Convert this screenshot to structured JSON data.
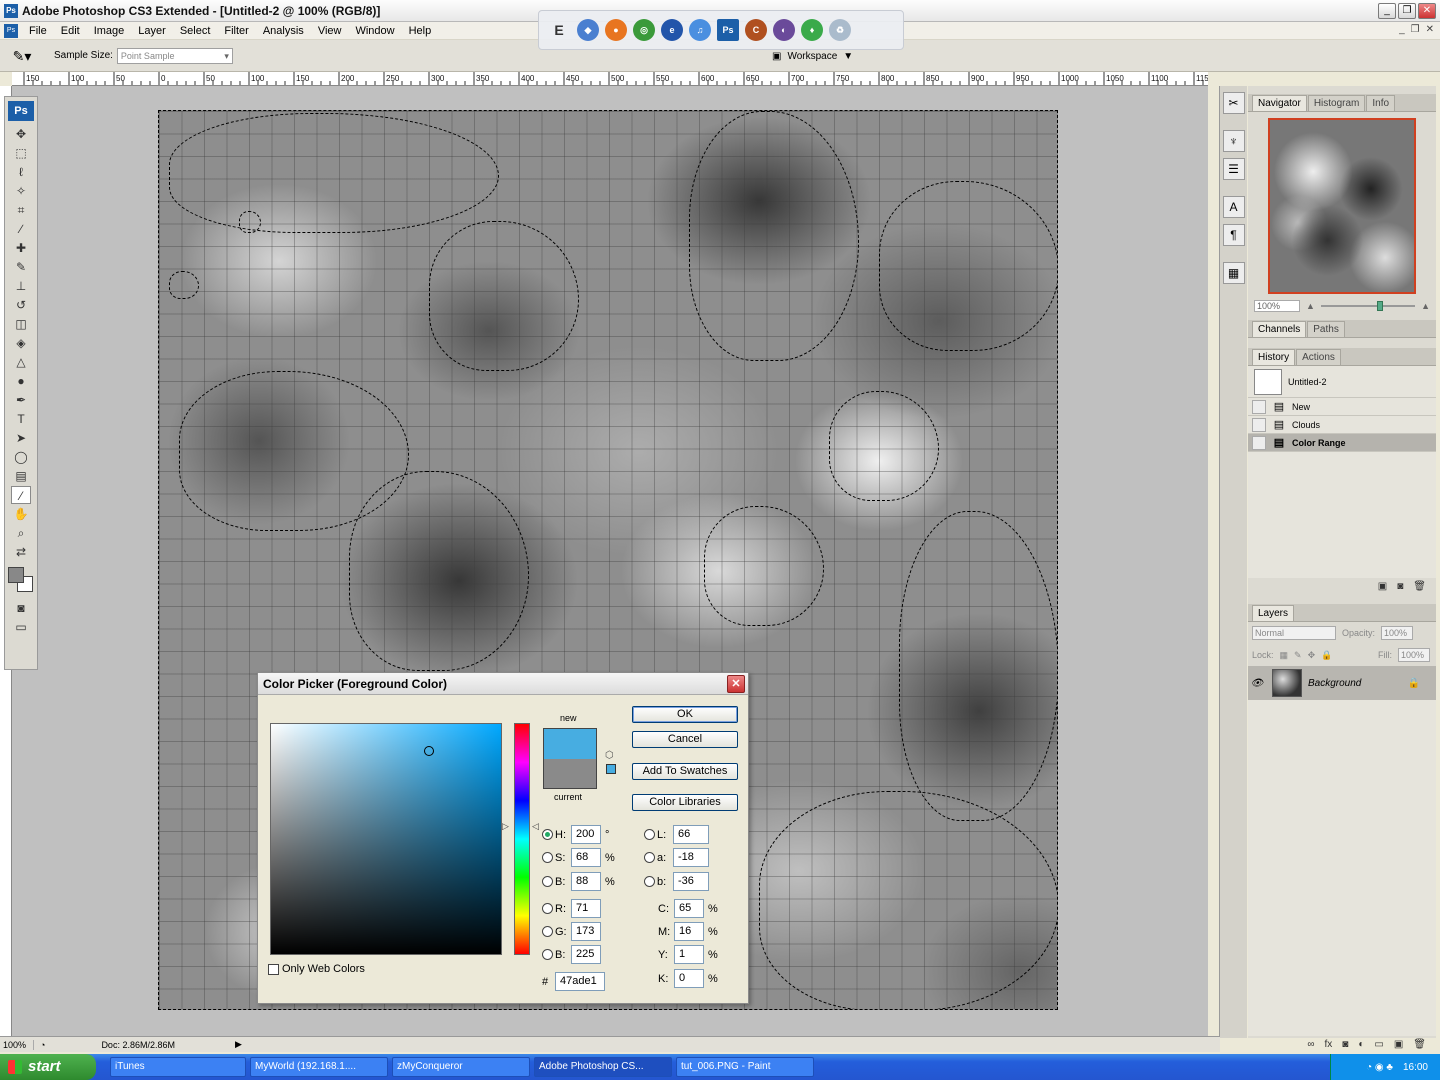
{
  "window": {
    "title": "Adobe Photoshop CS3 Extended - [Untitled-2 @ 100% (RGB/8)]"
  },
  "menu": [
    "File",
    "Edit",
    "Image",
    "Layer",
    "Select",
    "Filter",
    "Analysis",
    "View",
    "Window",
    "Help"
  ],
  "options_bar": {
    "sample_size_label": "Sample Size:",
    "sample_size_value": "Point Sample",
    "workspace_label": "Workspace"
  },
  "rulers": {
    "top_ticks": [
      "150",
      "100",
      "50",
      "0",
      "50",
      "100",
      "150",
      "200",
      "250",
      "300",
      "350",
      "400",
      "450",
      "500",
      "550",
      "600",
      "650",
      "700",
      "750",
      "800",
      "850",
      "900",
      "950",
      "1000",
      "1050",
      "1100",
      "115"
    ]
  },
  "status_bar": {
    "zoom": "100%",
    "doc": "Doc: 2.86M/2.86M"
  },
  "navigator": {
    "tabs": [
      "Navigator",
      "Histogram",
      "Info"
    ],
    "zoom": "100%"
  },
  "channels": {
    "tabs": [
      "Channels",
      "Paths"
    ]
  },
  "history": {
    "tabs": [
      "History",
      "Actions"
    ],
    "snapshot": "Untitled-2",
    "items": [
      "New",
      "Clouds",
      "Color Range"
    ]
  },
  "layers": {
    "tabs": [
      "Layers"
    ],
    "blend_mode": "Normal",
    "opacity_label": "Opacity:",
    "opacity": "100%",
    "lock_label": "Lock:",
    "fill_label": "Fill:",
    "fill": "100%",
    "layer_name": "Background"
  },
  "color_picker": {
    "title": "Color Picker (Foreground Color)",
    "new_label": "new",
    "current_label": "current",
    "buttons": {
      "ok": "OK",
      "cancel": "Cancel",
      "swatches": "Add To Swatches",
      "libraries": "Color Libraries"
    },
    "hsb": {
      "h": "200",
      "s": "68",
      "b": "88"
    },
    "rgb": {
      "r": "71",
      "g": "173",
      "b": "225"
    },
    "lab": {
      "l": "66",
      "a": "-18",
      "b": "-36"
    },
    "cmyk": {
      "c": "65",
      "m": "16",
      "y": "1",
      "k": "0"
    },
    "hex": "47ade1",
    "only_web_colors": "Only Web Colors",
    "new_color": "#47ade1",
    "current_color": "#8a8a8a"
  },
  "taskbar": {
    "start": "start",
    "tasks": [
      "iTunes",
      "MyWorld (192.168.1....",
      "zMyConqueror",
      "Adobe Photoshop CS...",
      "tut_006.PNG - Paint"
    ],
    "clock": "16:00"
  }
}
